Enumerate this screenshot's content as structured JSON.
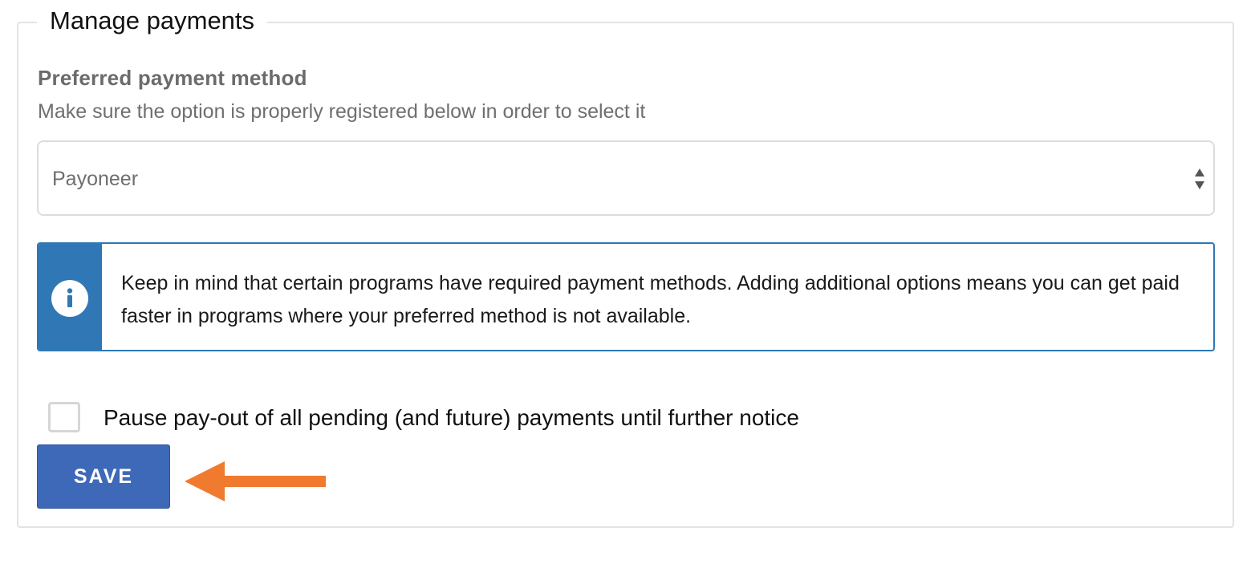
{
  "section": {
    "legend": "Manage payments"
  },
  "payment_method": {
    "label": "Preferred payment method",
    "help": "Make sure the option is properly registered below in order to select it",
    "selected_value": "Payoneer"
  },
  "notice": {
    "icon": "info-icon",
    "text": "Keep in mind that certain programs have required payment methods. Adding additional options means you can get paid faster in programs where your preferred method is not available."
  },
  "pause_payout": {
    "checked": false,
    "label": "Pause pay-out of all pending (and future) payments until further notice"
  },
  "actions": {
    "save_label": "SAVE"
  },
  "annotation": {
    "icon": "arrow-left-icon",
    "color": "#f07a2e"
  },
  "colors": {
    "info_accent": "#2f78b5",
    "primary_button": "#3e69b8"
  }
}
